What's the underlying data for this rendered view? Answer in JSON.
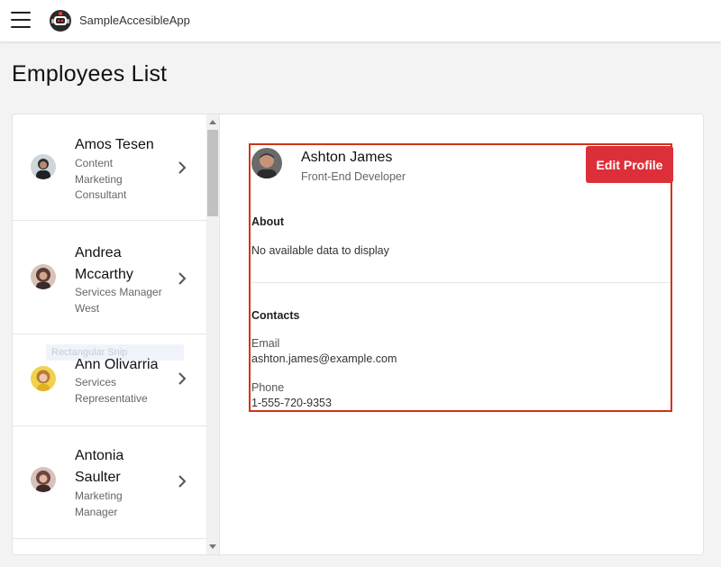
{
  "app": {
    "title": "SampleAccesibleApp"
  },
  "page": {
    "title": "Employees List"
  },
  "employees": [
    {
      "name": "Amos Tesen",
      "role": [
        "Content",
        "Marketing",
        "Consultant"
      ],
      "avatar_color": "#2b2e33"
    },
    {
      "name": "Andrea Mccarthy",
      "name_lines": [
        "Andrea",
        "Mccarthy"
      ],
      "role": [
        "Services Manager",
        "West"
      ],
      "avatar_color": "#5a3a35"
    },
    {
      "name": "Ann Olivarria",
      "role": [
        "Services",
        "Representative"
      ],
      "avatar_color": "#e0b020"
    },
    {
      "name": "Antonia Saulter",
      "name_lines": [
        "Antonia",
        "Saulter"
      ],
      "role": [
        "Marketing",
        "Manager"
      ],
      "avatar_color": "#6d4540"
    }
  ],
  "tooltip_ghost": "Rectangular Snip",
  "detail": {
    "name": "Ashton James",
    "title": "Front-End Developer",
    "edit_button": "Edit Profile",
    "about_label": "About",
    "about_text": "No available data to display",
    "contacts_label": "Contacts",
    "email_label": "Email",
    "email": "ashton.james@example.com",
    "phone_label": "Phone",
    "phone": "1-555-720-9353"
  },
  "colors": {
    "accent": "#dc2f3a",
    "selection_border": "#d33319",
    "background": "#f3f3f3"
  },
  "icons": [
    "menu-icon",
    "robot-logo-icon",
    "chevron-right-icon"
  ]
}
